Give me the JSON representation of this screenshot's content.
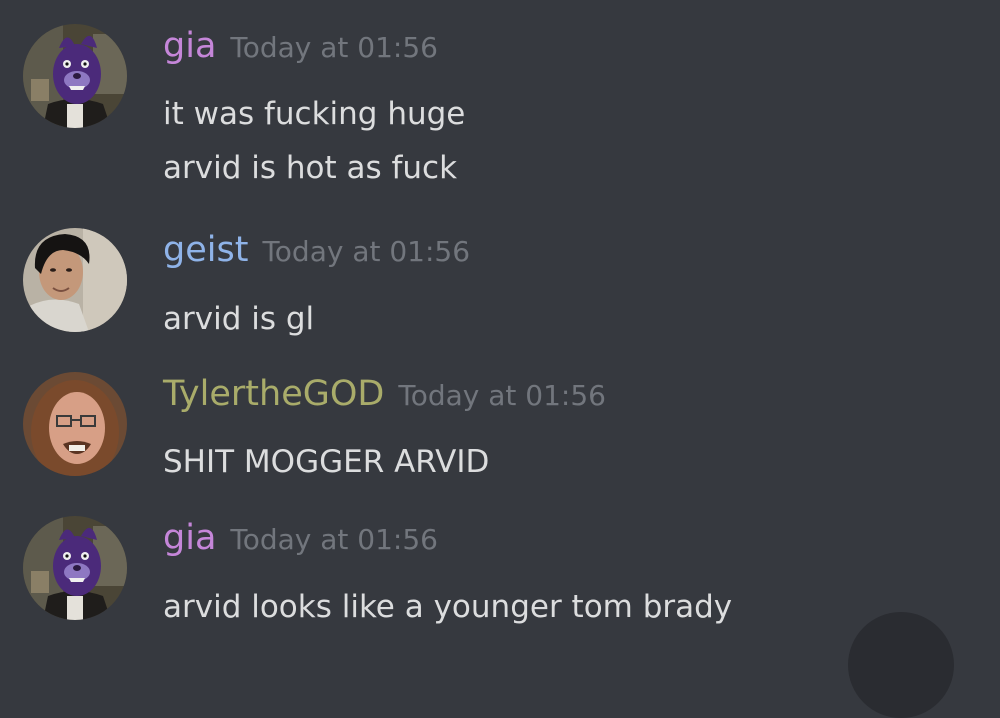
{
  "colors": {
    "background": "#36393f",
    "message_text": "#dcddde",
    "timestamp": "#72767d",
    "gia": "#c586d9",
    "geist": "#8fb3e8",
    "tylerthegod": "#a9ac6a"
  },
  "messages": [
    {
      "author": "gia",
      "timestamp": "Today at 01:56",
      "avatar": "purple-animatronic-mask-avatar",
      "lines": [
        "it was fucking huge",
        "arvid is hot as fuck"
      ]
    },
    {
      "author": "geist",
      "timestamp": "Today at 01:56",
      "avatar": "dark-haired-man-photo-avatar",
      "lines": [
        "arvid is gl"
      ]
    },
    {
      "author": "TylertheGOD",
      "timestamp": "Today at 01:56",
      "avatar": "man-with-glasses-photo-avatar",
      "lines": [
        "SHIT MOGGER ARVID"
      ]
    },
    {
      "author": "gia",
      "timestamp": "Today at 01:56",
      "avatar": "purple-animatronic-mask-avatar",
      "lines": [
        "arvid looks like a younger tom brady"
      ]
    }
  ]
}
